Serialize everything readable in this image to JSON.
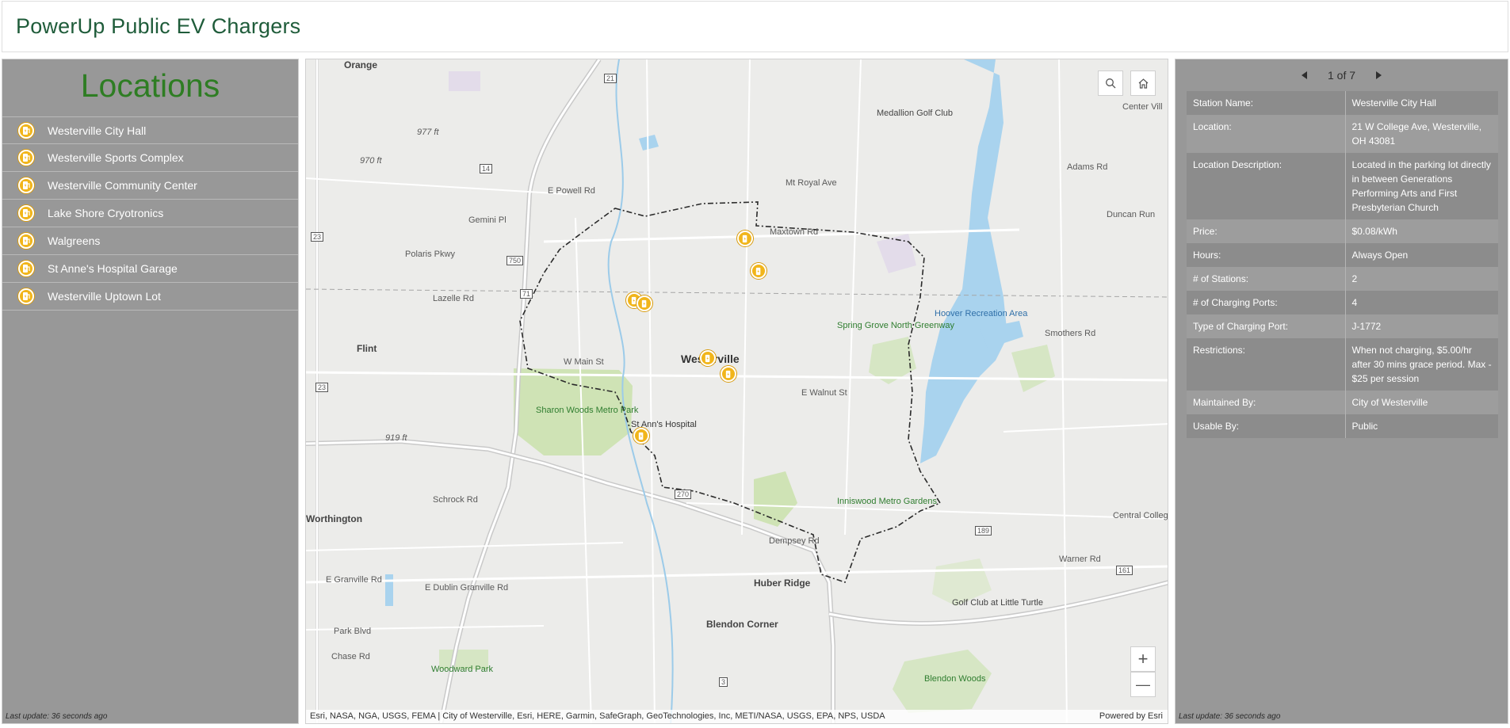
{
  "header": {
    "title": "PowerUp Public EV Chargers"
  },
  "left_panel": {
    "title": "Locations",
    "items": [
      {
        "label": "Westerville City Hall"
      },
      {
        "label": "Westerville Sports Complex"
      },
      {
        "label": "Westerville Community Center"
      },
      {
        "label": "Lake Shore Cryotronics"
      },
      {
        "label": "Walgreens"
      },
      {
        "label": "St Anne's Hospital Garage"
      },
      {
        "label": "Westerville Uptown Lot"
      }
    ],
    "last_update": "Last update: 36 seconds ago"
  },
  "map": {
    "labels": {
      "orange": "Orange",
      "medallion": "Medallion Golf Club",
      "westerville": "Westerville",
      "flint": "Flint",
      "sharon_woods": "Sharon Woods Metro Park",
      "st_anns": "St Ann's Hospital",
      "spring_grove": "Spring Grove North Greenway",
      "hoover": "Hoover Recreation Area",
      "inniswood": "Inniswood Metro Gardens",
      "huber_ridge": "Huber Ridge",
      "blendon_corner": "Blendon Corner",
      "golf_club_lt": "Golf Club at Little Turtle",
      "woodward_park": "Woodward Park",
      "blendon_woods": "Blendon Woods",
      "worthington": "Worthington",
      "maxtown": "Maxtown Rd",
      "lazelle": "Lazelle Rd",
      "smothers": "Smothers Rd",
      "w_main": "W Main St",
      "e_walnut": "E Walnut St",
      "schrock": "Schrock Rd",
      "dempsey": "Dempsey Rd",
      "e_dublin_granville": "E Dublin Granville Rd",
      "e_granville": "E Granville Rd",
      "park_blvd": "Park Blvd",
      "chase": "Chase Rd",
      "warner": "Warner Rd",
      "central_college": "Central College",
      "gemini": "Gemini Pl",
      "e_powell": "E Powell Rd",
      "polaris": "Polaris Pkwy",
      "mt_royal": "Mt Royal Ave",
      "adams": "Adams Rd",
      "duncan_run": "Duncan Run",
      "center_vill": "Center Vill",
      "elev_977": "977 ft",
      "elev_970": "970 ft",
      "elev_919": "919 ft",
      "rt_21": "21",
      "rt_14": "14",
      "rt_750": "750",
      "rt_23a": "23",
      "rt_23b": "23",
      "rt_71": "71",
      "rt_270": "270",
      "rt_189": "189",
      "rt_161": "161",
      "rt_3": "3"
    },
    "attribution": "Esri, NASA, NGA, USGS, FEMA | City of Westerville, Esri, HERE, Garmin, SafeGraph, GeoTechnologies, Inc, METI/NASA, USGS, EPA, NPS, USDA",
    "powered_by": "Powered by Esri",
    "buttons": {
      "search": "search-icon",
      "home": "home-icon",
      "zoom_in": "+",
      "zoom_out": "—"
    }
  },
  "right_panel": {
    "pager": {
      "text": "1 of 7"
    },
    "attributes": [
      {
        "key": "Station Name:",
        "value": "Westerville City Hall"
      },
      {
        "key": "Location:",
        "value": "21 W College Ave, Westerville, OH 43081"
      },
      {
        "key": "Location Description:",
        "value": "Located in the parking lot directly in between Generations Performing Arts and First Presbyterian Church"
      },
      {
        "key": "Price:",
        "value": "$0.08/kWh"
      },
      {
        "key": "Hours:",
        "value": "Always Open"
      },
      {
        "key": "# of Stations:",
        "value": "2"
      },
      {
        "key": "# of Charging Ports:",
        "value": "4"
      },
      {
        "key": "Type of Charging Port:",
        "value": "J-1772"
      },
      {
        "key": "Restrictions:",
        "value": "When not charging, $5.00/hr after 30 mins grace period. Max - $25 per session"
      },
      {
        "key": "Maintained By:",
        "value": "City of Westerville"
      },
      {
        "key": "Usable By:",
        "value": "Public"
      }
    ],
    "last_update": "Last update: 36 seconds ago"
  },
  "colors": {
    "accent_green": "#2e7d23",
    "header_title": "#1f5c3a",
    "panel_gray": "#989898",
    "marker_yellow": "#f1b51a",
    "water": "#a9d3ee",
    "park": "#cfe3b5"
  }
}
